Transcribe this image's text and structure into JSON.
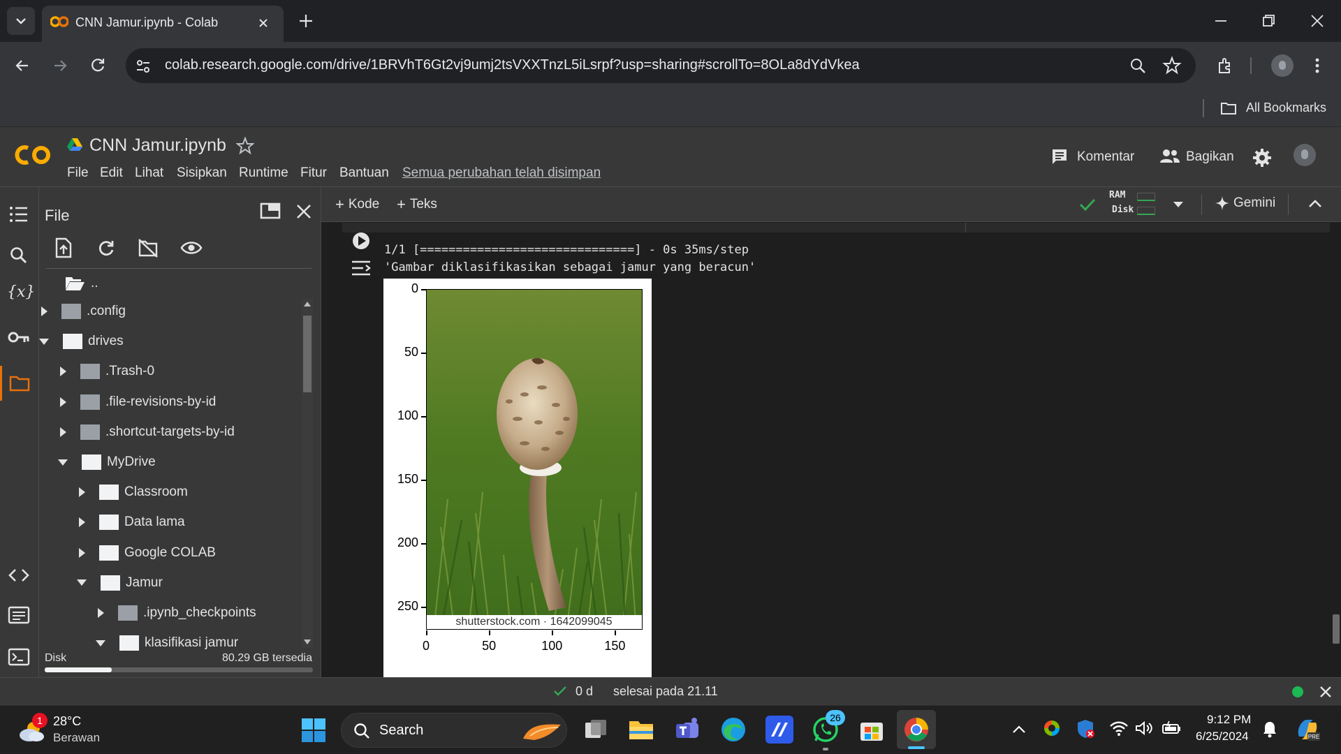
{
  "browser": {
    "tab_title": "CNN Jamur.ipynb - Colab",
    "url": "colab.research.google.com/drive/1BRVhT6Gt2vj9umj2tsVXXTnzL5iLsrpf?usp=sharing#scrollTo=8OLa8dYdVkea",
    "all_bookmarks": "All Bookmarks"
  },
  "colab": {
    "notebook_title": "CNN Jamur.ipynb",
    "menu": [
      "File",
      "Edit",
      "Lihat",
      "Sisipkan",
      "Runtime",
      "Fitur",
      "Bantuan"
    ],
    "saved_status": "Semua perubahan telah disimpan",
    "comment_label": "Komentar",
    "share_label": "Bagikan",
    "add_code": "Kode",
    "add_text": "Teks",
    "ram_label": "RAM",
    "disk_label": "Disk",
    "gemini_label": "Gemini"
  },
  "file_panel": {
    "title": "File",
    "parent_dir": "..",
    "tree": [
      {
        "label": ".config",
        "expanded": false,
        "depth": 0,
        "color": "gray"
      },
      {
        "label": "drives",
        "expanded": true,
        "depth": 0,
        "color": "white"
      },
      {
        "label": ".Trash-0",
        "expanded": false,
        "depth": 1,
        "color": "gray"
      },
      {
        "label": ".file-revisions-by-id",
        "expanded": false,
        "depth": 1,
        "color": "gray"
      },
      {
        "label": ".shortcut-targets-by-id",
        "expanded": false,
        "depth": 1,
        "color": "gray"
      },
      {
        "label": "MyDrive",
        "expanded": true,
        "depth": 1,
        "color": "white"
      },
      {
        "label": "Classroom",
        "expanded": false,
        "depth": 2,
        "color": "white"
      },
      {
        "label": "Data lama",
        "expanded": false,
        "depth": 2,
        "color": "white"
      },
      {
        "label": "Google COLAB",
        "expanded": false,
        "depth": 2,
        "color": "white"
      },
      {
        "label": "Jamur",
        "expanded": true,
        "depth": 2,
        "color": "white"
      },
      {
        "label": ".ipynb_checkpoints",
        "expanded": false,
        "depth": 3,
        "color": "gray"
      },
      {
        "label": "klasifikasi jamur",
        "expanded": true,
        "depth": 3,
        "color": "white"
      }
    ],
    "disk_label": "Disk",
    "disk_free": "80.29 GB tersedia",
    "disk_used_fraction": 0.25
  },
  "output": {
    "progress_line": "1/1 [==============================] - 0s 35ms/step",
    "result_line": "'Gambar diklasifikasikan sebagai jamur yang beracun'",
    "watermark": "shutterstock.com · 1642099045",
    "y_ticks": [
      "0",
      "50",
      "100",
      "150",
      "200",
      "250"
    ],
    "x_ticks": [
      "0",
      "50",
      "100",
      "150"
    ]
  },
  "status": {
    "elapsed": "0 d",
    "finished": "selesai pada 21.11"
  },
  "taskbar": {
    "weather_temp": "28°C",
    "weather_desc": "Berawan",
    "weather_badge": "1",
    "search_label": "Search",
    "whatsapp_badge": "26",
    "time": "9:12 PM",
    "date": "6/25/2024"
  }
}
